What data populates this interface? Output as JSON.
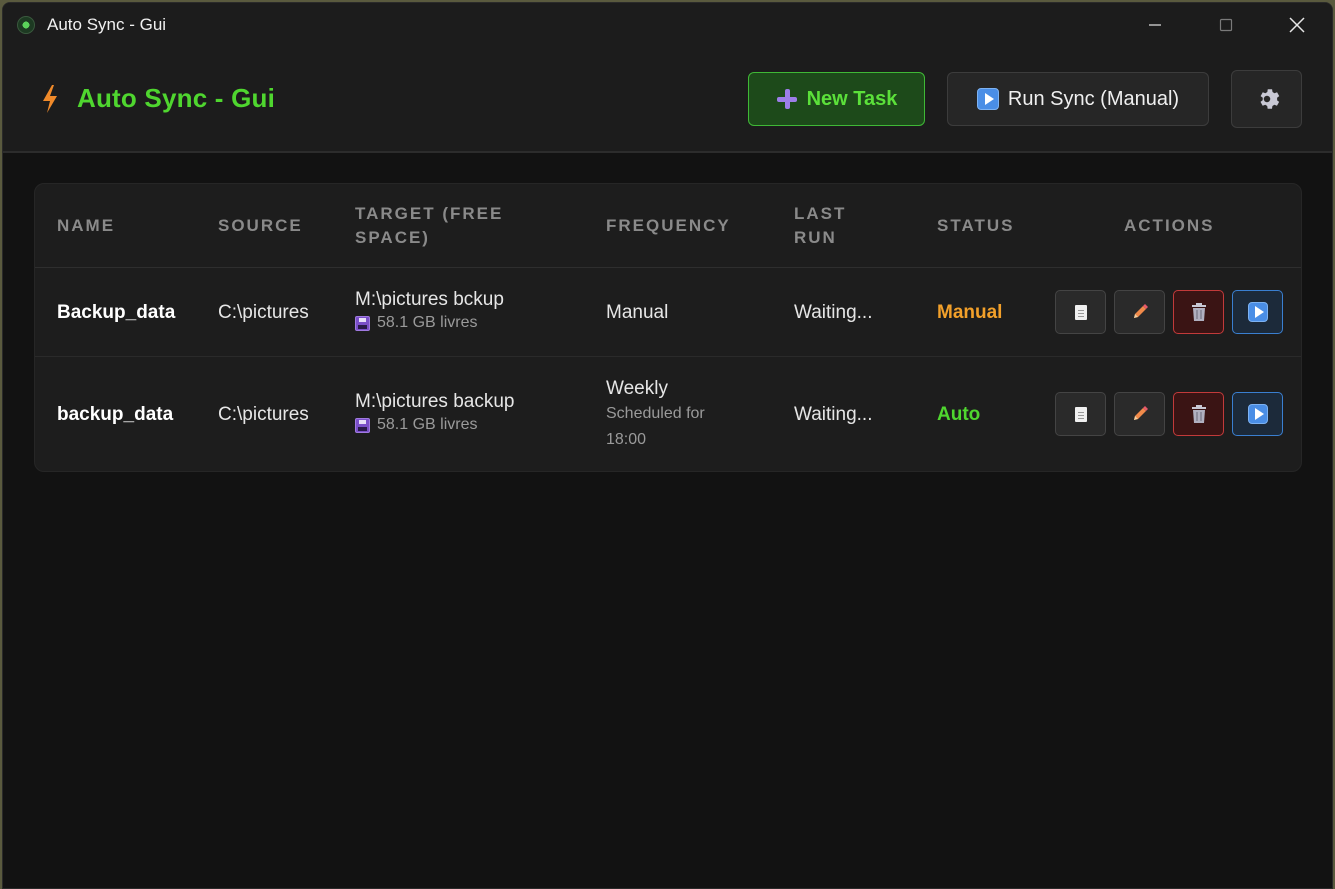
{
  "window": {
    "title": "Auto Sync - Gui"
  },
  "header": {
    "title": "Auto Sync - Gui",
    "new_task_label": "New Task",
    "run_sync_label": "Run Sync (Manual)"
  },
  "table": {
    "headers": {
      "name": "NAME",
      "source": "SOURCE",
      "target": "TARGET (FREE SPACE)",
      "frequency": "FREQUENCY",
      "last_run": "LAST RUN",
      "status": "STATUS",
      "actions": "ACTIONS"
    },
    "rows": [
      {
        "name": "Backup_data",
        "source": "C:\\pictures",
        "target": "M:\\pictures bckup",
        "free_space": "58.1 GB livres",
        "frequency": "Manual",
        "schedule": "",
        "last_run": "Waiting...",
        "status": "Manual"
      },
      {
        "name": "backup_data",
        "source": "C:\\pictures",
        "target": "M:\\pictures backup",
        "free_space": "58.1 GB livres",
        "frequency": "Weekly",
        "schedule_line1": "Scheduled for",
        "schedule_line2": "18:00",
        "last_run": "Waiting...",
        "status": "Auto"
      }
    ]
  },
  "colors": {
    "accent_green": "#4fd62f",
    "manual_orange": "#f2a02a",
    "delete_red": "#c23a3a",
    "run_blue": "#3a7fd0"
  },
  "icons": [
    "app-logo-icon",
    "bolt-icon",
    "plus-icon",
    "play-icon",
    "gear-icon",
    "document-icon",
    "pencil-icon",
    "trash-icon",
    "floppy-disk-icon"
  ]
}
